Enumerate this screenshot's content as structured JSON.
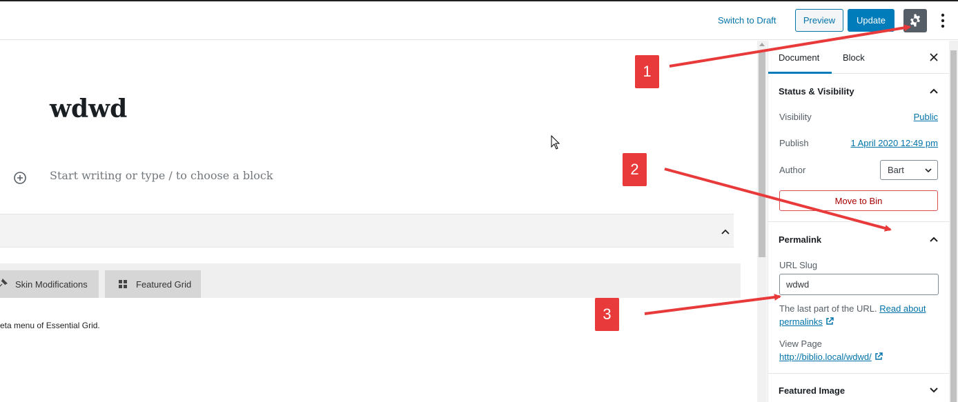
{
  "topbar": {
    "switch_draft": "Switch to Draft",
    "preview": "Preview",
    "update": "Update",
    "settings_icon": "gear-icon",
    "more_icon": "vertical-ellipsis-icon"
  },
  "editor": {
    "post_title": "wdwd",
    "placeholder": "Start writing or type / to choose a block",
    "meta_tabs": [
      {
        "label": "Skin Modifications",
        "icon": "pin-icon"
      },
      {
        "label": "Featured Grid",
        "icon": "grid-icon"
      }
    ],
    "meta_text": "eta menu of Essential Grid."
  },
  "sidebar": {
    "tabs": [
      "Document",
      "Block"
    ],
    "active_tab": "Document",
    "status": {
      "title": "Status & Visibility",
      "visibility_label": "Visibility",
      "visibility_value": "Public",
      "publish_label": "Publish",
      "publish_value": "1 April 2020 12:49 pm",
      "author_label": "Author",
      "author_value": "Bart",
      "move_to_bin": "Move to Bin"
    },
    "permalink": {
      "title": "Permalink",
      "slug_label": "URL Slug",
      "slug_value": "wdwd",
      "help_prefix": "The last part of the URL. ",
      "help_link": "Read about permalinks",
      "view_label": "View Page",
      "view_url": "http://biblio.local/wdwd/"
    },
    "featured_image": {
      "title": "Featured Image"
    }
  },
  "callouts": [
    "1",
    "2",
    "3"
  ],
  "colors": {
    "primary": "#007cba",
    "link": "#0073aa",
    "danger": "#a00",
    "callout": "#e83a3a",
    "gear_bg": "#555d66"
  }
}
